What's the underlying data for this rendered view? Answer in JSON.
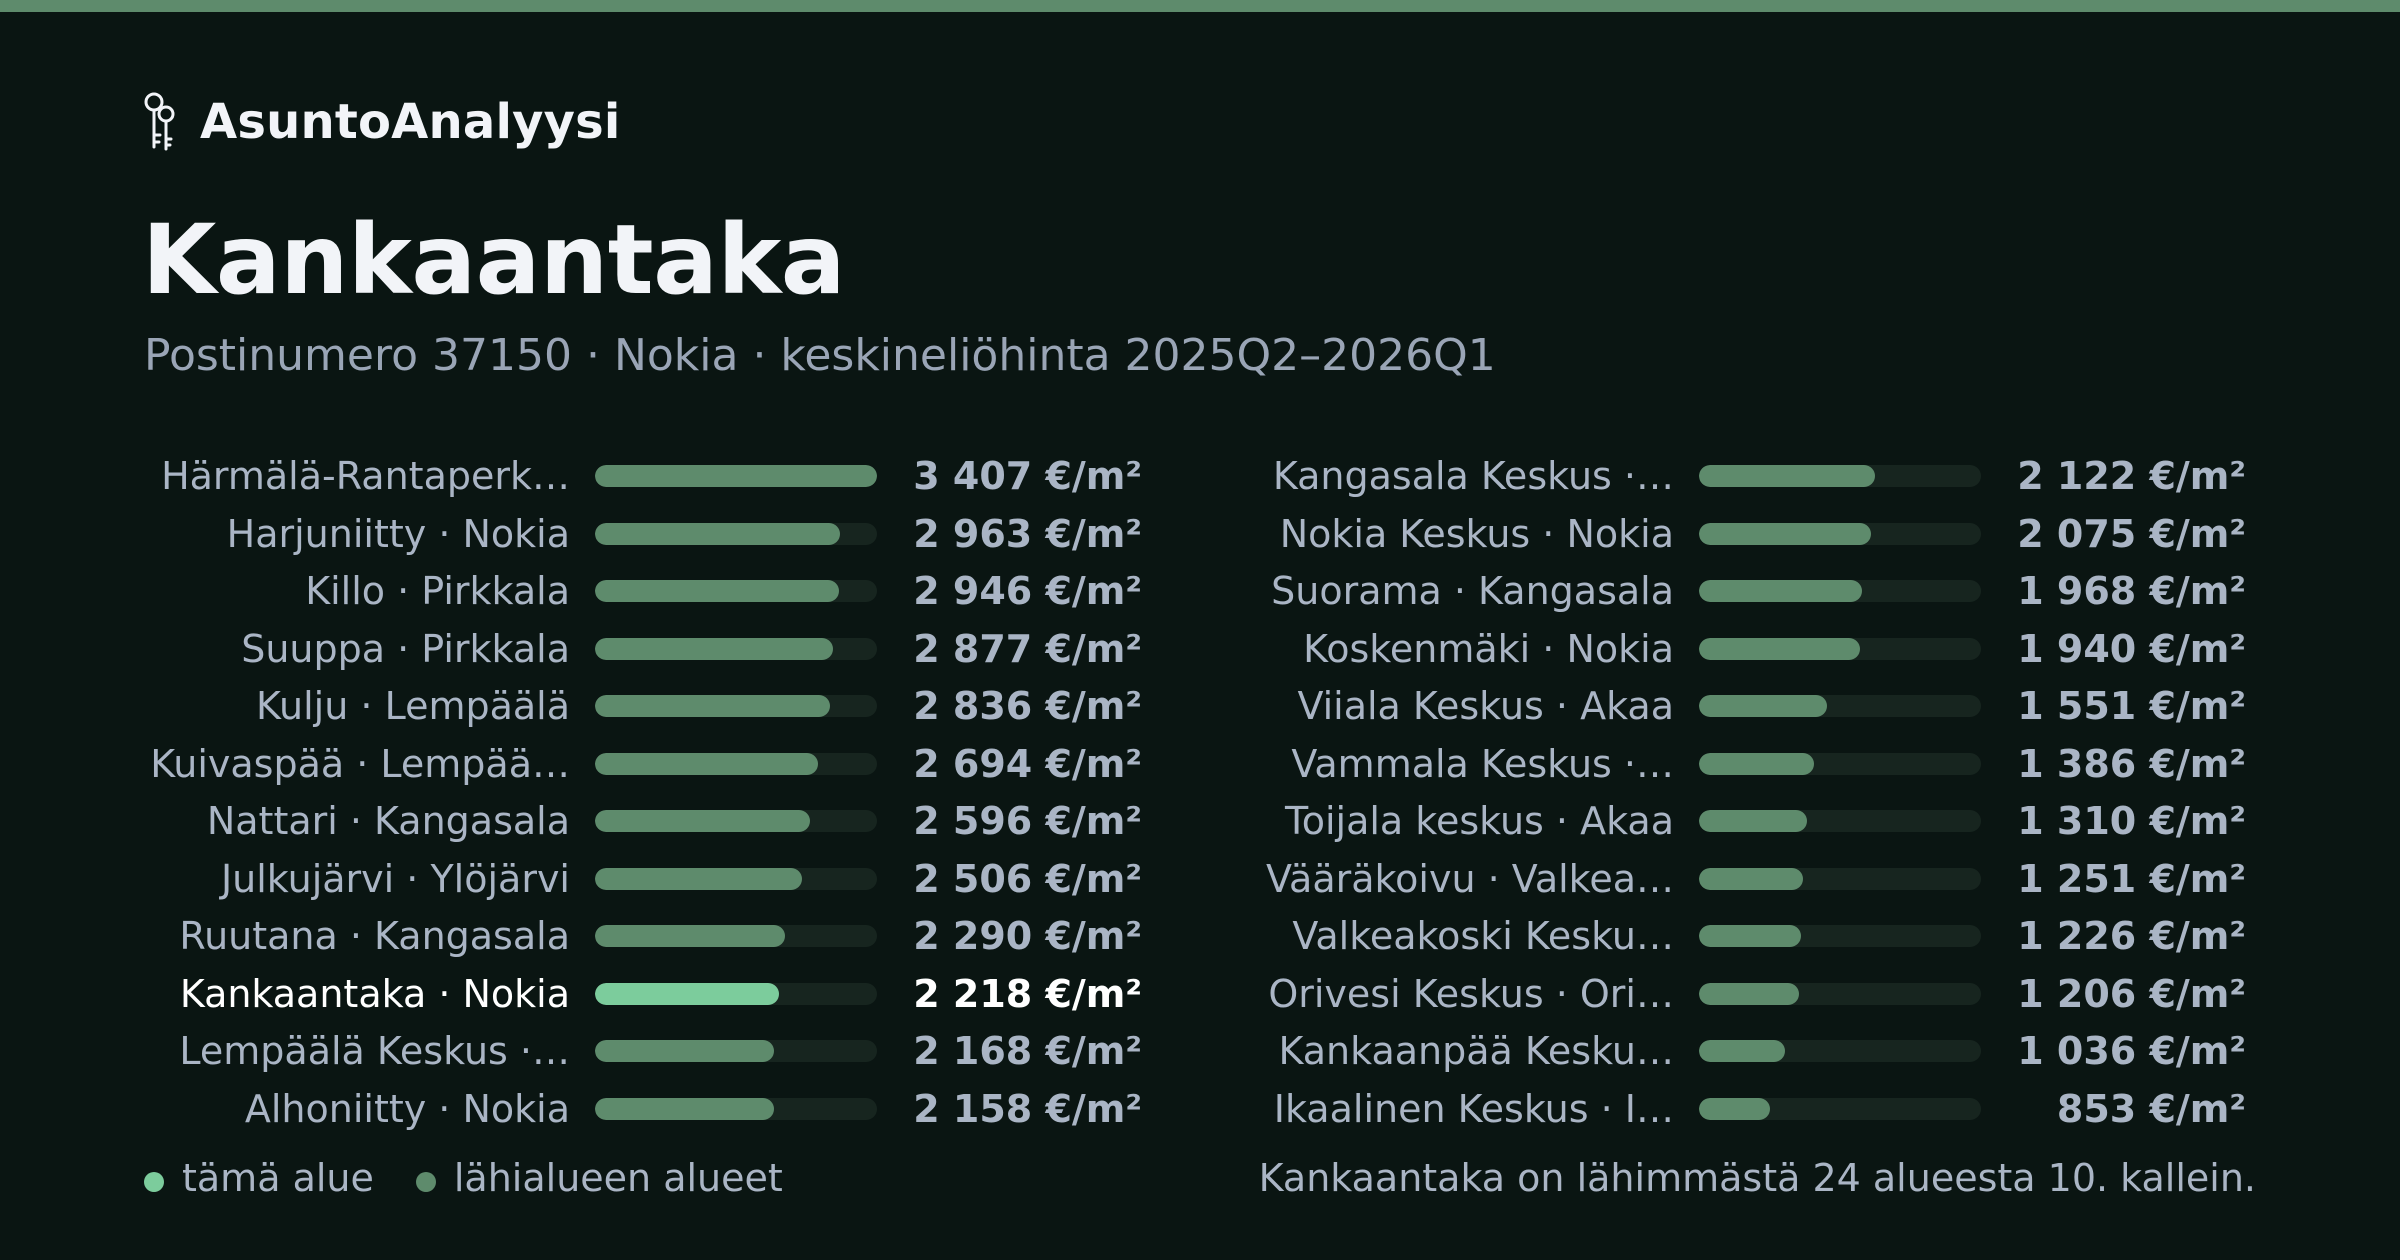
{
  "brand": {
    "name": "AsuntoAnalyysi",
    "icon": "keys-icon"
  },
  "header": {
    "title": "Kankaantaka",
    "subtitle": "Postinumero 37150 · Nokia · keskineliöhinta 2025Q2–2026Q1"
  },
  "colors": {
    "background": "#0a1512",
    "accent_stripe": "#5e8b6c",
    "bar_other": "#5e8b6c",
    "bar_current": "#7ccc9c",
    "bar_track": "#17251f",
    "text_primary": "#f2f4f8",
    "text_secondary": "#aab5c5"
  },
  "legend": {
    "current_label": "tämä alue",
    "others_label": "lähialueen alueet"
  },
  "footnote": "Kankaantaka on lähimmästä 24 alueesta 10. kallein.",
  "chart_data": {
    "type": "bar",
    "orientation": "horizontal",
    "unit": "€/m²",
    "xlim": [
      0,
      3407
    ],
    "legend_position": "bottom-left",
    "highlight_index": 9,
    "categories": [
      "Härmälä-Rantaperk…",
      "Harjuniitty · Nokia",
      "Killo · Pirkkala",
      "Suuppa · Pirkkala",
      "Kulju · Lempäälä",
      "Kuivaspää · Lempää…",
      "Nattari · Kangasala",
      "Julkujärvi · Ylöjärvi",
      "Ruutana · Kangasala",
      "Kankaantaka · Nokia",
      "Lempäälä Keskus ·…",
      "Alhoniitty · Nokia",
      "Kangasala Keskus ·…",
      "Nokia Keskus · Nokia",
      "Suorama · Kangasala",
      "Koskenmäki · Nokia",
      "Viiala Keskus · Akaa",
      "Vammala Keskus ·…",
      "Toijala keskus · Akaa",
      "Vääräkoivu · Valkea…",
      "Valkeakoski Kesku…",
      "Orivesi Keskus · Ori…",
      "Kankaanpää Kesku…",
      "Ikaalinen Keskus · I…"
    ],
    "values": [
      3407,
      2963,
      2946,
      2877,
      2836,
      2694,
      2596,
      2506,
      2290,
      2218,
      2168,
      2158,
      2122,
      2075,
      1968,
      1940,
      1551,
      1386,
      1310,
      1251,
      1226,
      1206,
      1036,
      853
    ],
    "value_labels": [
      "3 407 €/m²",
      "2 963 €/m²",
      "2 946 €/m²",
      "2 877 €/m²",
      "2 836 €/m²",
      "2 694 €/m²",
      "2 596 €/m²",
      "2 506 €/m²",
      "2 290 €/m²",
      "2 218 €/m²",
      "2 168 €/m²",
      "2 158 €/m²",
      "2 122 €/m²",
      "2 075 €/m²",
      "1 968 €/m²",
      "1 940 €/m²",
      "1 551 €/m²",
      "1 386 €/m²",
      "1 310 €/m²",
      "1 251 €/m²",
      "1 226 €/m²",
      "1 206 €/m²",
      "1 036 €/m²",
      "853 €/m²"
    ]
  }
}
